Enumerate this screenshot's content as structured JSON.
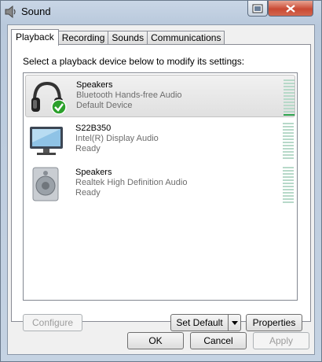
{
  "window": {
    "title": "Sound"
  },
  "tabs": [
    {
      "label": "Playback",
      "active": true
    },
    {
      "label": "Recording",
      "active": false
    },
    {
      "label": "Sounds",
      "active": false
    },
    {
      "label": "Communications",
      "active": false
    }
  ],
  "panel": {
    "instruction": "Select a playback device below to modify its settings:"
  },
  "devices": [
    {
      "name": "Speakers",
      "description": "Bluetooth Hands-free Audio",
      "status": "Default Device",
      "icon": "headphones-icon",
      "selected": true,
      "default": true,
      "level": 0.1
    },
    {
      "name": "S22B350",
      "description": "Intel(R) Display Audio",
      "status": "Ready",
      "icon": "monitor-icon",
      "selected": false,
      "level": 0
    },
    {
      "name": "Speakers",
      "description": "Realtek High Definition Audio",
      "status": "Ready",
      "icon": "speaker-icon",
      "selected": false,
      "level": 0
    }
  ],
  "buttons": {
    "configure": "Configure",
    "set_default": "Set Default",
    "properties": "Properties",
    "ok": "OK",
    "cancel": "Cancel",
    "apply": "Apply"
  },
  "colors": {
    "meter_idle": "#b7d9c9",
    "meter_active": "#2ea44f",
    "default_check": "#2ca02c"
  }
}
